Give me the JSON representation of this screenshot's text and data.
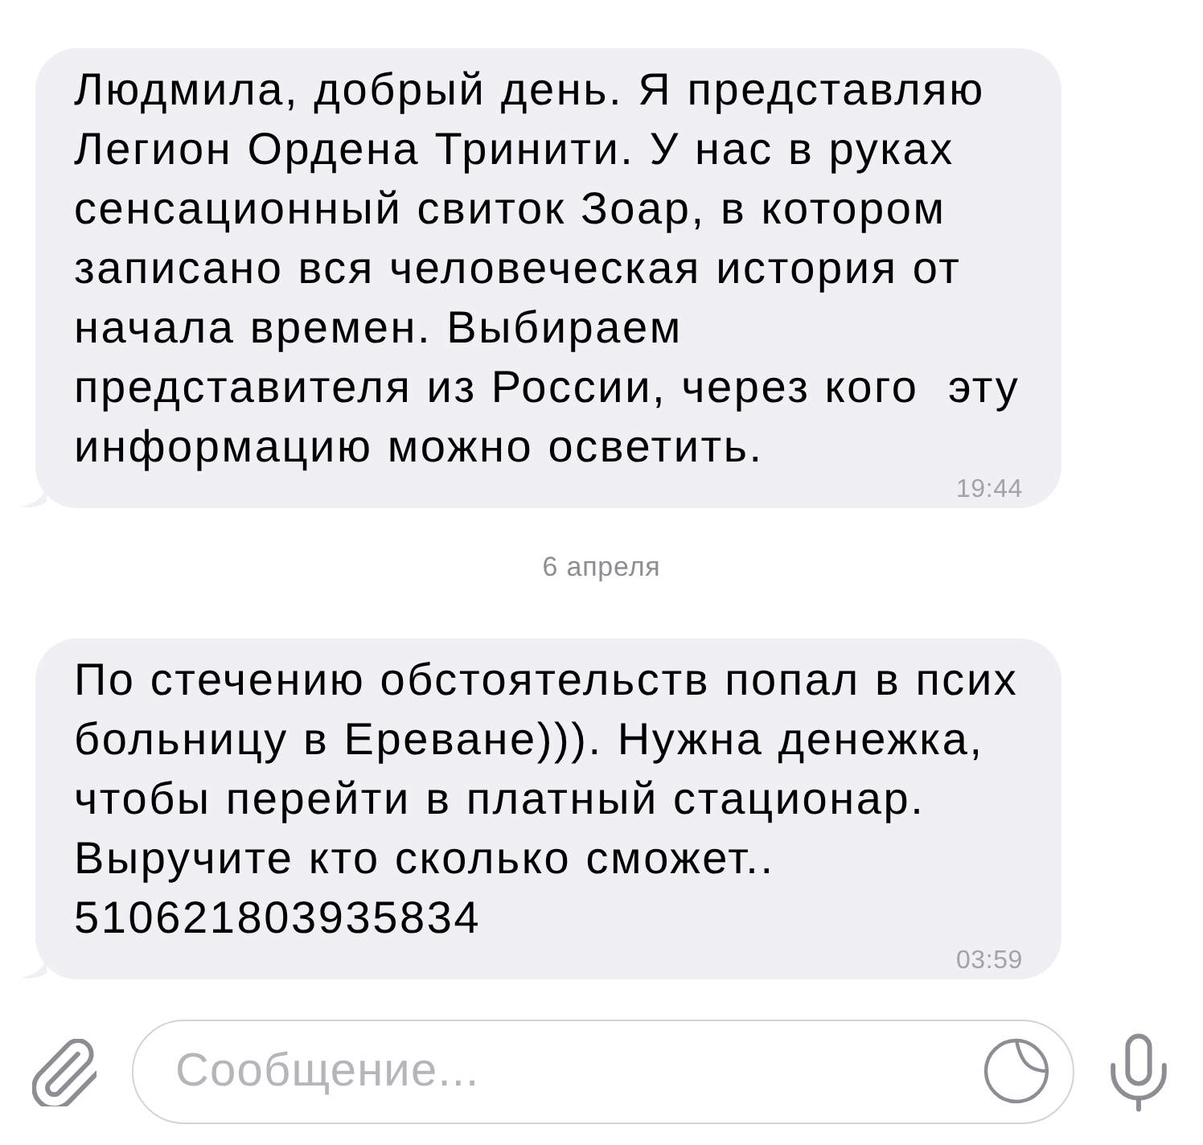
{
  "chat": [
    {
      "kind": "message",
      "text": "Людмила, добрый день. Я представляю Легион Ордена Тринити. У нас в руках сенсационный свиток Зоар, в котором записано вся человеческая история от начала времен. Выбираем представителя из России, через кого  эту информацию можно осветить.",
      "time": "19:44"
    },
    {
      "kind": "date",
      "text": "6 апреля"
    },
    {
      "kind": "message",
      "text": "По стечению обстоятельств попал в псих больницу в Ереване))). Нужна денежка, чтобы перейти в платный стационар. Выручите кто сколько сможет.. 510621803935834",
      "time": "03:59"
    }
  ],
  "composer": {
    "placeholder": "Сообщение..."
  }
}
